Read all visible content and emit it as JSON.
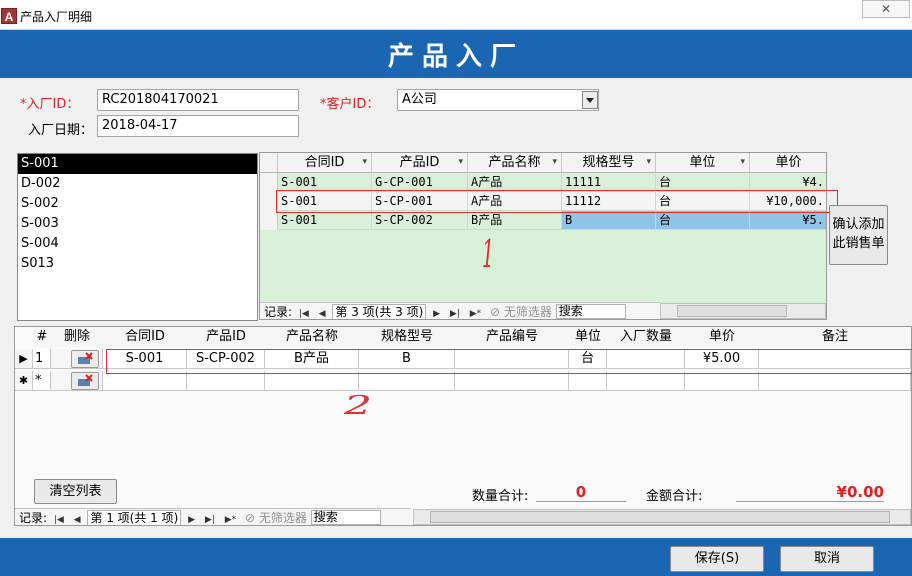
{
  "window": {
    "app_icon_letter": "A",
    "title": "产品入厂明细",
    "close_glyph": "✕"
  },
  "header": {
    "title": "产品入厂"
  },
  "form": {
    "entry_id_label": "入厂ID：",
    "entry_id_value": "RC201804170021",
    "customer_id_label": "客户ID：",
    "customer_id_value": "A公司",
    "entry_date_label": "入厂日期：",
    "entry_date_value": "2018-04-17",
    "required_mark": "*"
  },
  "contract_list": [
    "S-001",
    "D-002",
    "S-002",
    "S-003",
    "S-004",
    "S013"
  ],
  "upper_grid": {
    "columns": [
      "合同ID",
      "产品ID",
      "产品名称",
      "规格型号",
      "单位",
      "单价"
    ],
    "rows": [
      [
        "S-001",
        "G-CP-001",
        "A产品",
        "11111",
        "台",
        "¥4."
      ],
      [
        "S-001",
        "S-CP-001",
        "A产品",
        "11112",
        "台",
        "¥10,000."
      ],
      [
        "S-001",
        "S-CP-002",
        "B产品",
        "B",
        "台",
        "¥5."
      ]
    ],
    "nav": {
      "record_label": "记录:",
      "position": "第 3 项(共 3 项)",
      "filter": "无筛选器",
      "search": "搜索"
    }
  },
  "confirm_button": {
    "label_line1": "确认添加",
    "label_line2": "此销售单"
  },
  "lower_grid": {
    "columns": [
      "#",
      "删除",
      "合同ID",
      "产品ID",
      "产品名称",
      "规格型号",
      "产品编号",
      "单位",
      "入厂数量",
      "单价",
      "备注"
    ],
    "rows": [
      {
        "num": "1",
        "contract_id": "S-001",
        "product_id": "S-CP-002",
        "product_name": "B产品",
        "spec": "B",
        "product_code": "",
        "unit": "台",
        "qty": "",
        "price": "¥5.00",
        "remark": ""
      },
      {
        "num": "*",
        "contract_id": "",
        "product_id": "",
        "product_name": "",
        "spec": "",
        "product_code": "",
        "unit": "",
        "qty": "",
        "price": "",
        "remark": ""
      }
    ],
    "nav": {
      "record_label": "记录:",
      "position": "第 1 项(共 1 项)",
      "filter": "无筛选器",
      "search": "搜索"
    }
  },
  "clear_button": {
    "label": "清空列表"
  },
  "summary": {
    "qty_label": "数量合计:",
    "qty_value": "0",
    "amount_label": "金额合计:",
    "amount_value": "¥0.00"
  },
  "actions": {
    "save": "保存(S)",
    "cancel": "取消"
  },
  "annotations": {
    "mark1": "1",
    "mark2": "2"
  },
  "colors": {
    "header_blue": "#1a66b3",
    "grid_green": "#d8f0d8",
    "selected_blue": "#8fc4e8",
    "annotation_red": "#e03030"
  },
  "icons": [
    "app-access-icon",
    "close-icon",
    "combo-arrow-icon",
    "nav-first-icon",
    "nav-prev-icon",
    "nav-next-icon",
    "nav-last-icon",
    "nav-new-icon",
    "filter-icon",
    "delete-row-icon"
  ]
}
